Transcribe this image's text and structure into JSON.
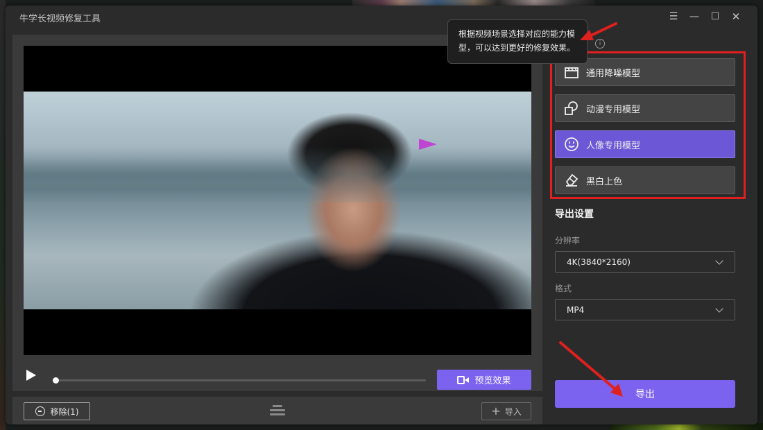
{
  "window": {
    "title": "牛学长视频修复工具"
  },
  "tooltip": {
    "line1": "根据视频场景选择对应的能力模",
    "line2": "型，可以达到更好的修复效果。"
  },
  "models": [
    {
      "label": "通用降噪模型",
      "icon": "clapperboard-icon",
      "active": false
    },
    {
      "label": "动漫专用模型",
      "icon": "shapes-icon",
      "active": false
    },
    {
      "label": "人像专用模型",
      "icon": "portrait-icon",
      "active": true
    },
    {
      "label": "黑白上色",
      "icon": "eraser-icon",
      "active": false
    }
  ],
  "export_settings": {
    "title": "导出设置",
    "resolution_label": "分辨率",
    "resolution_value": "4K(3840*2160)",
    "format_label": "格式",
    "format_value": "MP4",
    "export_label": "导出"
  },
  "player": {
    "preview_label": "预览效果",
    "progress": 0.0
  },
  "bottom": {
    "remove_label": "移除(1)",
    "import_label": "导入"
  },
  "colors": {
    "accent": "#7b63f0",
    "highlight_box": "#e0201e",
    "active_model": "#6c58d6"
  }
}
